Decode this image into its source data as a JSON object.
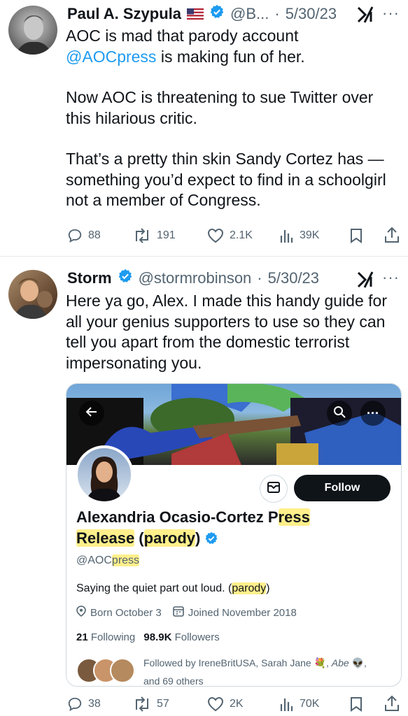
{
  "tweet1": {
    "display_name": "Paul A. Szypula",
    "flag": "🇺🇸",
    "handle": "@B...",
    "date": "5/30/23",
    "body": {
      "line1": "AOC is mad that parody account",
      "mention": "@AOCpress",
      "line2_rest": " is making fun of her.",
      "p2": "Now AOC is threatening to sue Twitter over this hilarious critic.",
      "p3": "That’s a pretty thin skin Sandy Cortez has — something you’d expect to find in a schoolgirl not a member of Congress."
    },
    "stats": {
      "replies": "88",
      "retweets": "191",
      "likes": "2.1K",
      "views": "39K"
    }
  },
  "tweet2": {
    "display_name": "Storm",
    "handle": "@stormrobinson",
    "date": "5/30/23",
    "body": "Here ya go, Alex. I made this handy guide for all your genius supporters to use so they can tell you apart from the domestic terrorist impersonating you.",
    "stats": {
      "replies": "38",
      "retweets": "57",
      "likes": "2K",
      "views": "70K"
    }
  },
  "profile": {
    "name_a": "Alexandria Ocasio-Cortez P",
    "name_b": "ress",
    "name_c": "Release",
    "name_d": " (",
    "name_e": "parody",
    "name_f": ")",
    "handle_a": "@AOC",
    "handle_b": "press",
    "bio_a": "Saying the quiet part out loud. (",
    "bio_b": "parody",
    "bio_c": ")",
    "born": "Born October 3",
    "joined": "Joined November 2018",
    "following_count": "21",
    "following_label": " Following",
    "followers_count": "98.9K",
    "followers_label": " Followers",
    "followed_by_line1": "Followed by IreneBritUSA, Sarah Jane",
    "followed_by_abe": "Abe",
    "followed_by_line2": "and 69 others",
    "follow_button": "Follow"
  },
  "colors": {
    "accent": "#1d9bf0",
    "verified": "#1d9bf0",
    "highlight": "#ffe85a",
    "dark_button": "#0f1419"
  }
}
